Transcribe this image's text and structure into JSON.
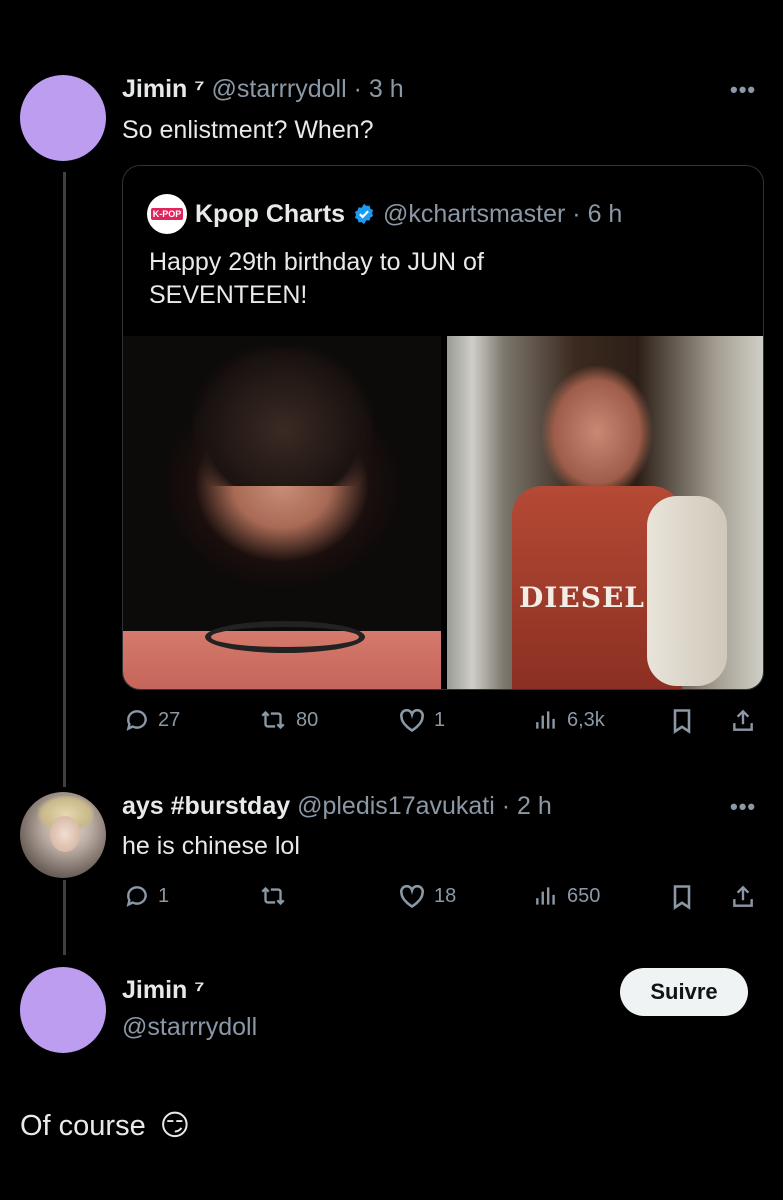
{
  "colors": {
    "background": "#000000",
    "text": "#e7e9ea",
    "muted": "#8b98a5",
    "avatar_purple": "#bc9df0",
    "verified_blue": "#1d9bf0",
    "thread_line": "#3e4144"
  },
  "tweet1": {
    "name": "Jimin ⁷",
    "handle": "@starrrydoll · 3 h",
    "text": "So enlistment? When?",
    "more_icon": "more-horizontal-icon",
    "quote": {
      "logo_text": "K-POP",
      "name": "Kpop Charts",
      "handle": "@kchartsmaster · 6 h",
      "text": "Happy 29th birthday to JUN of SEVENTEEN!",
      "photo_right_text": "DIESEL"
    },
    "actions": {
      "replies": "27",
      "reposts": "80",
      "likes": "1",
      "views": "6,3k"
    }
  },
  "tweet2": {
    "name": "ays #burstday",
    "handle": "@pledis17avukati · 2 h",
    "text": "he is chinese lol",
    "actions": {
      "replies": "1",
      "reposts": "",
      "likes": "18",
      "views": "650"
    }
  },
  "main_tweet": {
    "name": "Jimin ⁷",
    "handle": "@starrrydoll",
    "follow_label": "Suivre",
    "text": "Of course",
    "emoji": "😏"
  },
  "icons": {
    "reply": "reply-icon",
    "repost": "repost-icon",
    "like": "heart-icon",
    "views": "views-chart-icon",
    "bookmark": "bookmark-icon",
    "share": "share-icon",
    "verified": "verified-badge-icon"
  }
}
